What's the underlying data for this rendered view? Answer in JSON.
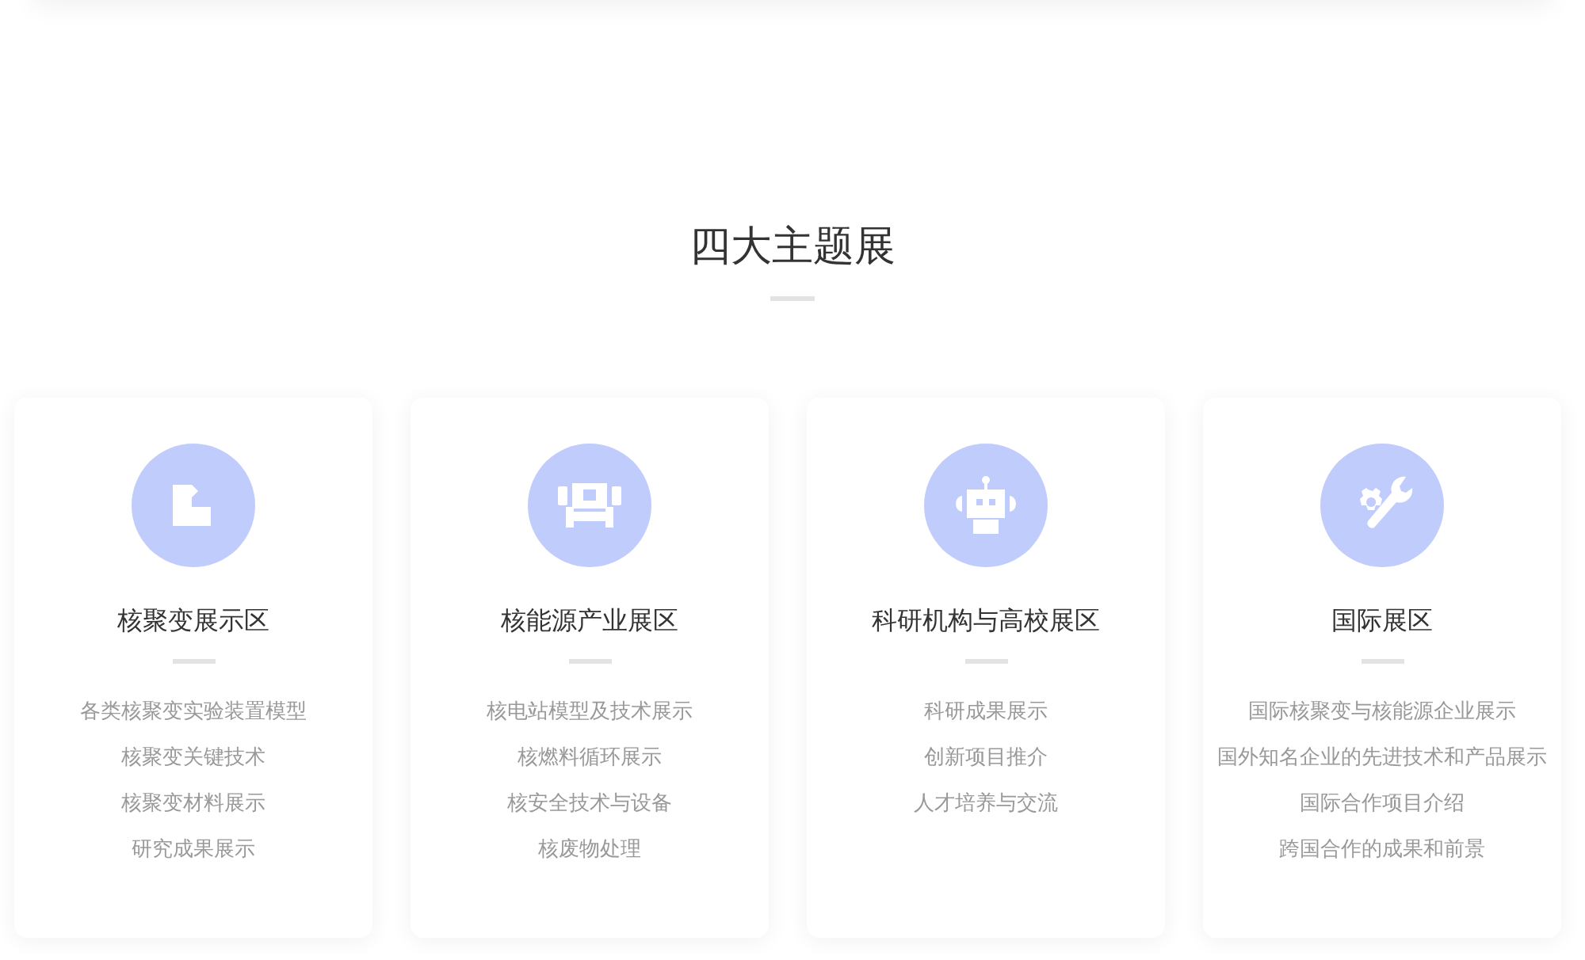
{
  "section": {
    "title": "四大主题展"
  },
  "cards": [
    {
      "title": "核聚变展示区",
      "items": [
        "各类核聚变实验装置模型",
        "核聚变关键技术",
        "核聚变材料展示",
        "研究成果展示"
      ]
    },
    {
      "title": "核能源产业展区",
      "items": [
        "核电站模型及技术展示",
        "核燃料循环展示",
        "核安全技术与设备",
        "核废物处理"
      ]
    },
    {
      "title": "科研机构与高校展区",
      "items": [
        "科研成果展示",
        "创新项目推介",
        "人才培养与交流"
      ]
    },
    {
      "title": "国际展区",
      "items": [
        "国际核聚变与核能源企业展示",
        "国外知名企业的先进技术和产品展示",
        "国际合作项目介绍",
        "跨国合作的成果和前景"
      ]
    }
  ]
}
